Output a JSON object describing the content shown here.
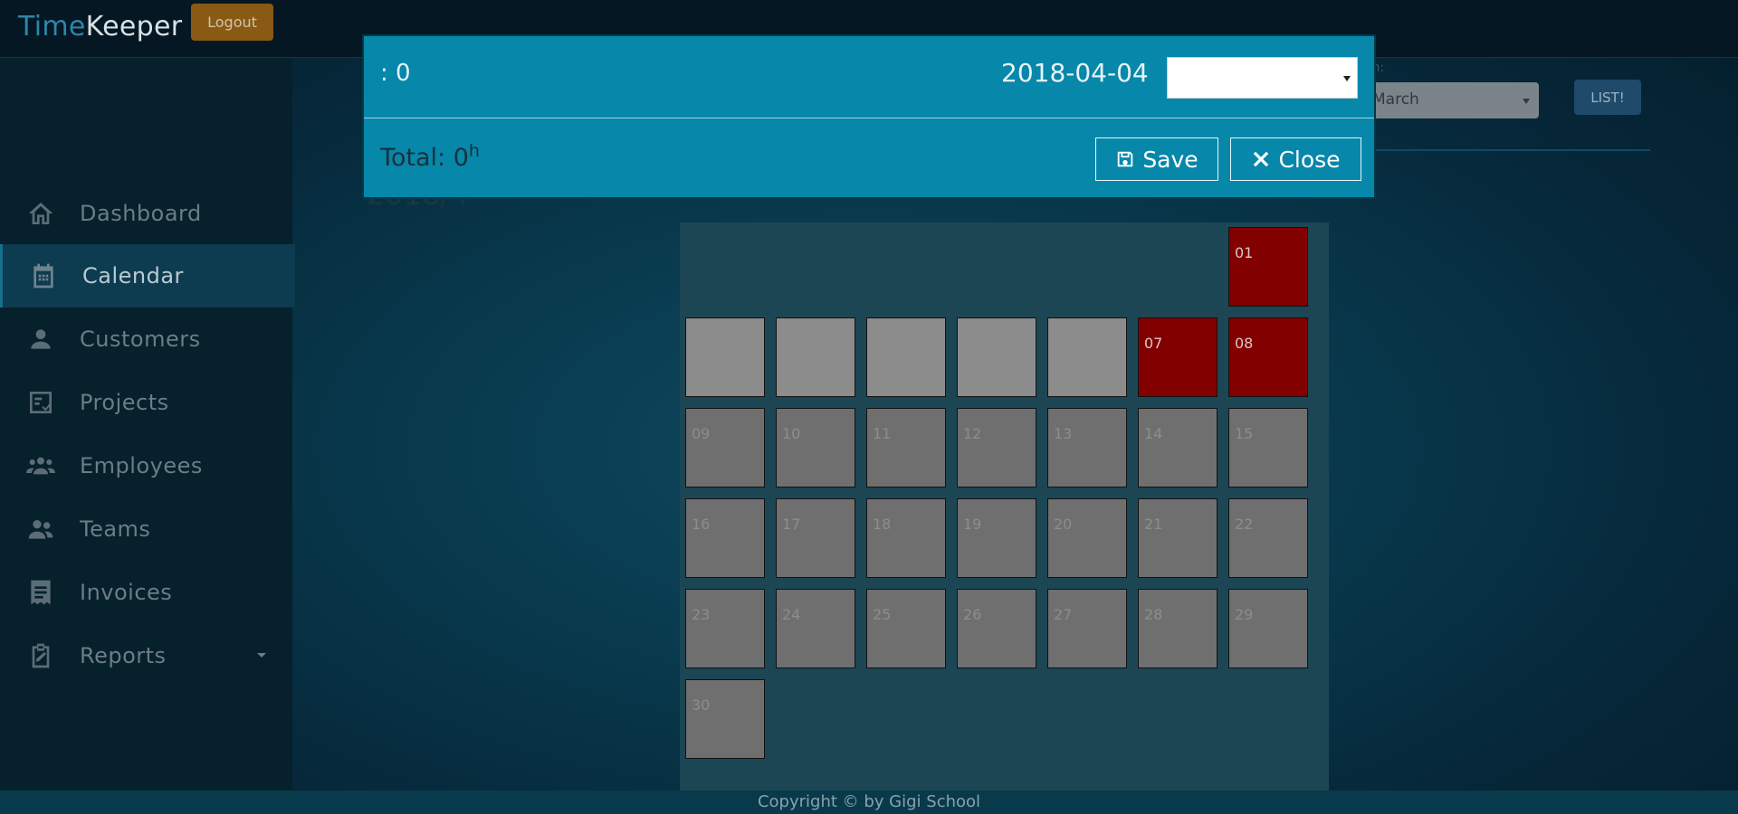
{
  "app": {
    "brand_part1": "Time",
    "brand_part2": "Keeper",
    "logout_label": "Logout"
  },
  "sidebar": {
    "items": [
      {
        "label": "Dashboard",
        "icon": "home-icon"
      },
      {
        "label": "Calendar",
        "icon": "calendar-icon",
        "active": true
      },
      {
        "label": "Customers",
        "icon": "user-icon"
      },
      {
        "label": "Projects",
        "icon": "checklist-icon"
      },
      {
        "label": "Employees",
        "icon": "users-group-icon"
      },
      {
        "label": "Teams",
        "icon": "users-icon"
      },
      {
        "label": "Invoices",
        "icon": "receipt-icon"
      },
      {
        "label": "Reports",
        "icon": "clipboard-icon"
      }
    ]
  },
  "controls": {
    "month_label": "th:",
    "month_value": "March",
    "list_label": "LIST!"
  },
  "page": {
    "year_text": "2018/4"
  },
  "calendar": {
    "days": [
      "01",
      "07",
      "08",
      "09",
      "10",
      "11",
      "12",
      "13",
      "14",
      "15",
      "16",
      "17",
      "18",
      "19",
      "20",
      "21",
      "22",
      "23",
      "24",
      "25",
      "26",
      "27",
      "28",
      "29",
      "30"
    ]
  },
  "modal": {
    "hours_text": ": 0",
    "date": "2018-04-04",
    "select_value": "",
    "total_label": "Total: 0",
    "total_unit": "h",
    "save_label": "Save",
    "close_label": "Close"
  },
  "footer": {
    "text": "Copyright © by Gigi School"
  },
  "colors": {
    "accent": "#0787aa",
    "holiday": "#820000",
    "brand": "#2e86a8"
  }
}
